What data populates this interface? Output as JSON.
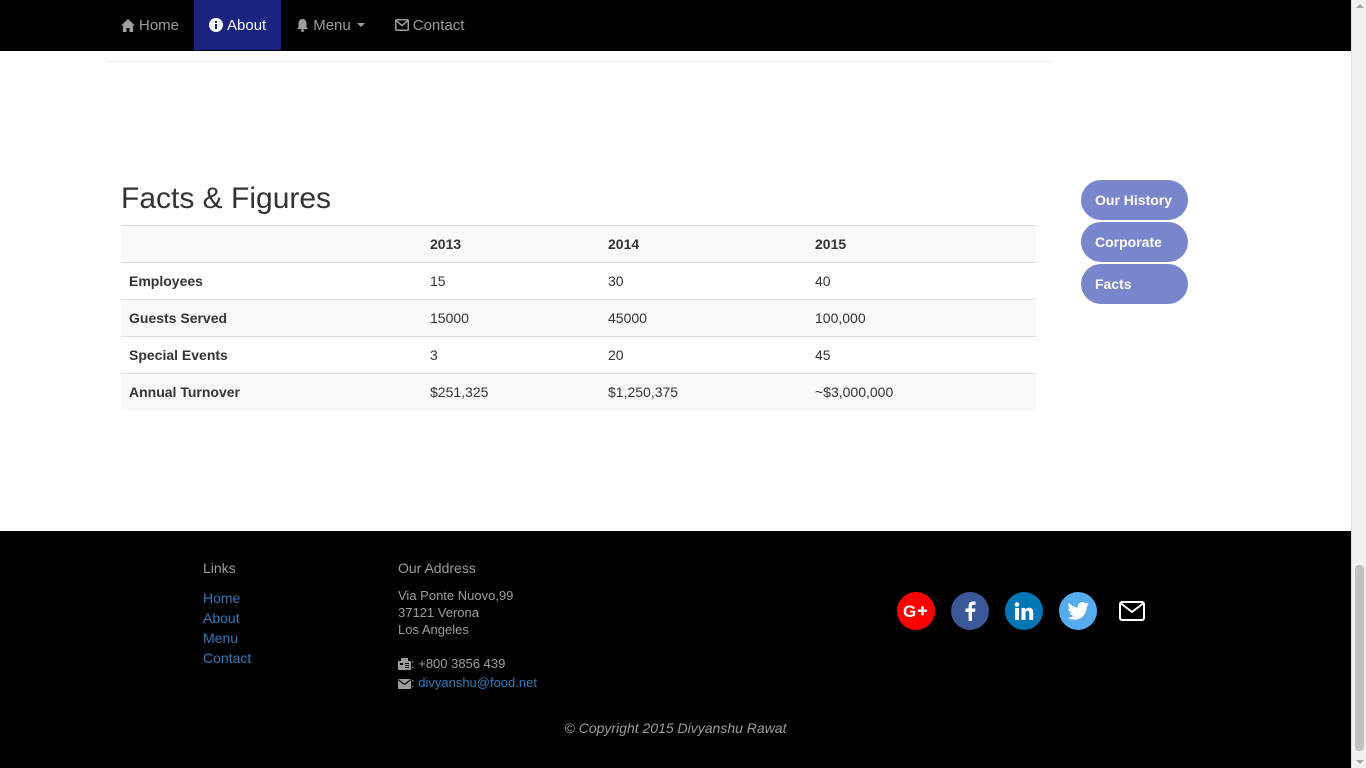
{
  "nav": {
    "items": [
      {
        "label": "Home",
        "icon": "home-icon"
      },
      {
        "label": "About",
        "icon": "info-circle-icon",
        "active": true
      },
      {
        "label": "Menu",
        "icon": "bell-icon",
        "dropdown": true
      },
      {
        "label": "Contact",
        "icon": "envelope-icon"
      }
    ]
  },
  "main": {
    "title": "Facts & Figures",
    "table": {
      "headers": [
        "",
        "2013",
        "2014",
        "2015"
      ],
      "rows": [
        {
          "label": "Employees",
          "values": [
            "15",
            "30",
            "40"
          ]
        },
        {
          "label": "Guests Served",
          "values": [
            "15000",
            "45000",
            "100,000"
          ]
        },
        {
          "label": "Special Events",
          "values": [
            "3",
            "20",
            "45"
          ]
        },
        {
          "label": "Annual Turnover",
          "values": [
            "$251,325",
            "$1,250,375",
            "~$3,000,000"
          ]
        }
      ]
    }
  },
  "sidebar": {
    "pills": [
      "Our History",
      "Corporate",
      "Facts"
    ]
  },
  "footer": {
    "links_heading": "Links",
    "links": [
      "Home",
      "About",
      "Menu",
      "Contact"
    ],
    "address_heading": "Our Address",
    "address_lines": [
      "Via Ponte Nuovo,99",
      "37121 Verona",
      "Los Angeles"
    ],
    "phone": ": +800 3856 439",
    "email_prefix": ": ",
    "email": "divyanshu@food.net",
    "social": [
      "google-plus-icon",
      "facebook-icon",
      "linkedin-icon",
      "twitter-icon",
      "envelope-icon"
    ],
    "copyright": "© Copyright 2015 Divyanshu Rawat"
  },
  "colors": {
    "navbar_bg": "#000000",
    "nav_active_bg": "#1a237e",
    "pill_bg": "#7986cb",
    "link": "#337ab7",
    "google": "#ff0000",
    "facebook": "#3b5998",
    "linkedin": "#0077b5",
    "twitter": "#55acee"
  }
}
